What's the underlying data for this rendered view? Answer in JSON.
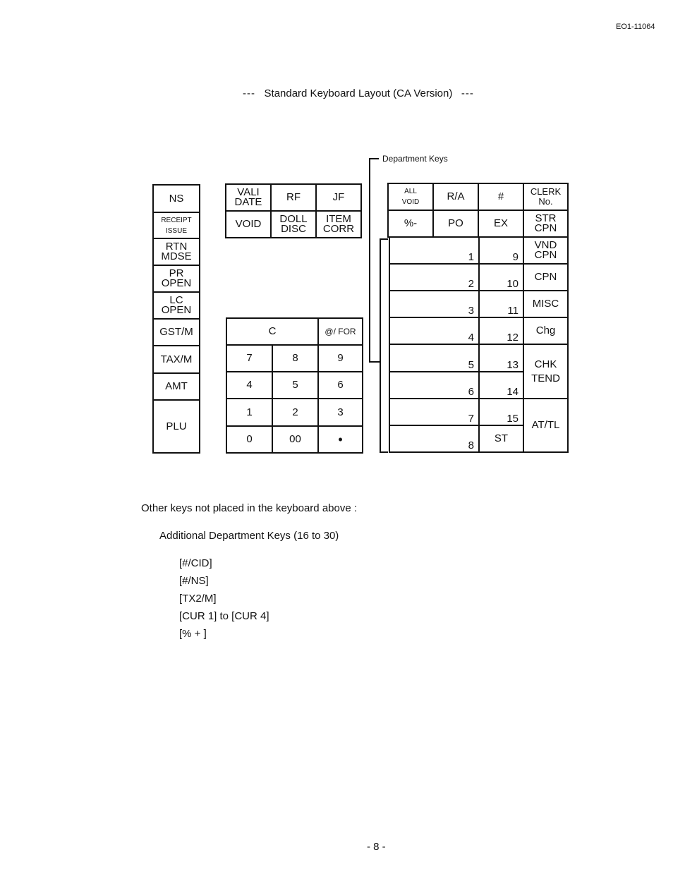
{
  "header": {
    "doc_number": "EO1-11064"
  },
  "title": {
    "prefix": "---",
    "text": "Standard Keyboard Layout (CA Version)",
    "suffix": "---"
  },
  "bracket_label": "Department Keys",
  "left_column": [
    {
      "label": "NS"
    },
    {
      "label": "RECEIPT\nISSUE"
    },
    {
      "label": "RTN\nMDSE"
    },
    {
      "label": "PR\nOPEN"
    },
    {
      "label": "LC\nOPEN"
    },
    {
      "label": "GST/M"
    },
    {
      "label": "TAX/M"
    },
    {
      "label": "AMT"
    },
    {
      "label": "PLU"
    }
  ],
  "function_block": [
    {
      "label": "VALI\nDATE"
    },
    {
      "label": "RF"
    },
    {
      "label": "JF"
    },
    {
      "label": "VOID"
    },
    {
      "label": "DOLL\nDISC"
    },
    {
      "label": "ITEM\nCORR"
    }
  ],
  "numpad": {
    "clear": "C",
    "at_for": "@/ FOR",
    "keys": [
      "7",
      "8",
      "9",
      "4",
      "5",
      "6",
      "1",
      "2",
      "3",
      "0",
      "00",
      "•"
    ]
  },
  "right_block": {
    "top_row1": [
      "ALL\nVOID",
      "R/A",
      "#",
      "CLERK\nNo."
    ],
    "top_row2": [
      "%-",
      "PO",
      "EX",
      "STR\nCPN"
    ],
    "dept_col1": [
      "1",
      "2",
      "3",
      "4",
      "5",
      "6",
      "7",
      "8"
    ],
    "dept_col2": [
      "9",
      "10",
      "11",
      "12",
      "13",
      "14",
      "15",
      "ST"
    ],
    "func_col": [
      "VND\nCPN",
      "CPN",
      "MISC",
      "Chg",
      "CHK\nTEND",
      "AT/TL"
    ]
  },
  "notes": {
    "intro": "Other keys not placed in the keyboard above :",
    "additional": "Additional Department Keys (16 to 30)",
    "items": [
      "[#/CID]",
      "[#/NS]",
      "[TX2/M]",
      "[CUR 1] to [CUR 4]",
      "[% + ]"
    ]
  },
  "footer": {
    "page": "- 8 -"
  }
}
